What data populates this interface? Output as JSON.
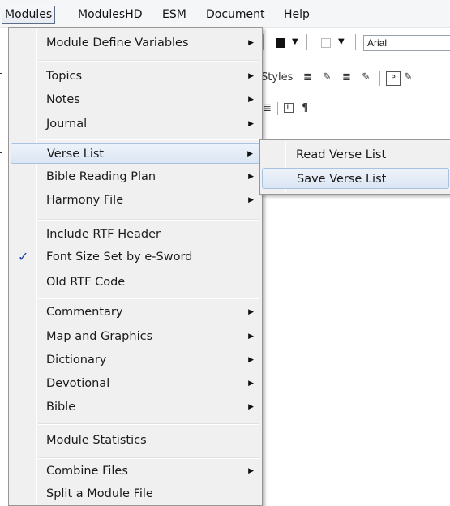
{
  "menubar": {
    "items": [
      "Modules",
      "ModulesHD",
      "ESM",
      "Document",
      "Help"
    ]
  },
  "toolbar": {
    "font_name": "Arial",
    "styles_label": "Styles",
    "pilcrow": "¶"
  },
  "menu": {
    "items": [
      {
        "label": "Module Define Variables",
        "submenu": true
      },
      {
        "label": "Topics",
        "submenu": true
      },
      {
        "label": "Notes",
        "submenu": true
      },
      {
        "label": "Journal",
        "submenu": true
      },
      {
        "label": "Verse List",
        "submenu": true,
        "highlighted": true
      },
      {
        "label": "Bible Reading Plan",
        "submenu": true
      },
      {
        "label": "Harmony File",
        "submenu": true
      },
      {
        "label": "Include RTF Header",
        "submenu": false
      },
      {
        "label": "Font Size Set by e-Sword",
        "submenu": false,
        "checked": true
      },
      {
        "label": "Old RTF Code",
        "submenu": false
      },
      {
        "label": "Commentary",
        "submenu": true
      },
      {
        "label": "Map and Graphics",
        "submenu": true
      },
      {
        "label": "Dictionary",
        "submenu": true
      },
      {
        "label": "Devotional",
        "submenu": true
      },
      {
        "label": "Bible",
        "submenu": true
      },
      {
        "label": "Module Statistics",
        "submenu": false
      },
      {
        "label": "Combine Files",
        "submenu": true
      },
      {
        "label": "Split a Module File",
        "submenu": false
      }
    ],
    "check_glyph": "✓",
    "arrow_glyph": "▶"
  },
  "submenu": {
    "items": [
      {
        "label": "Read Verse List"
      },
      {
        "label": "Save Verse List",
        "highlighted": true
      }
    ]
  },
  "colors": {
    "menu_bg": "#f0f0f0",
    "highlight_border": "#a8c2e3",
    "check": "#1d3fa8"
  }
}
